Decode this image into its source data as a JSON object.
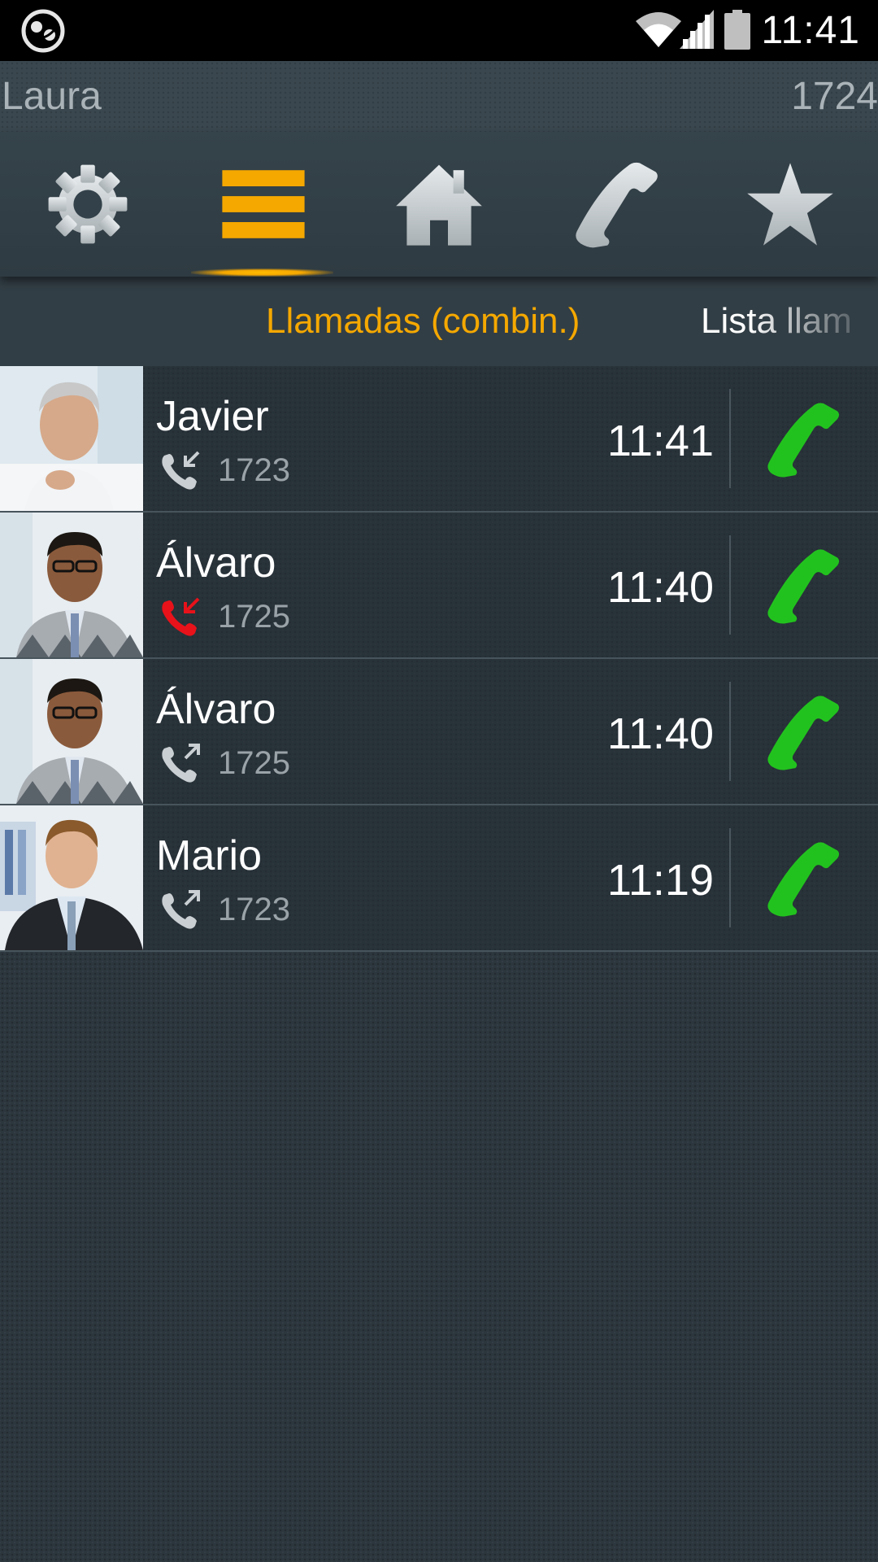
{
  "status_bar": {
    "time": "11:41",
    "icons": [
      "app-icon",
      "wifi-icon",
      "signal-icon",
      "battery-icon"
    ]
  },
  "user": {
    "name": "Laura",
    "extension": "1724"
  },
  "toolbar": {
    "items": [
      {
        "icon": "gear-icon"
      },
      {
        "icon": "list-icon",
        "active": true
      },
      {
        "icon": "home-icon"
      },
      {
        "icon": "phone-icon"
      },
      {
        "icon": "star-icon"
      }
    ],
    "active_color": "#f5a800"
  },
  "tabs": {
    "active": "Llamadas (combin.)",
    "next": "Lista llam"
  },
  "calls": [
    {
      "name": "Javier",
      "number": "1723",
      "time": "11:41",
      "direction": "incoming",
      "direction_icon": "incoming-call-icon"
    },
    {
      "name": "Álvaro",
      "number": "1725",
      "time": "11:40",
      "direction": "missed",
      "direction_icon": "missed-call-icon"
    },
    {
      "name": "Álvaro",
      "number": "1725",
      "time": "11:40",
      "direction": "outgoing",
      "direction_icon": "outgoing-call-icon"
    },
    {
      "name": "Mario",
      "number": "1723",
      "time": "11:19",
      "direction": "outgoing",
      "direction_icon": "outgoing-call-icon"
    }
  ],
  "colors": {
    "accent": "#f5a800",
    "call_green": "#22c21e",
    "missed_red": "#e8121a"
  }
}
